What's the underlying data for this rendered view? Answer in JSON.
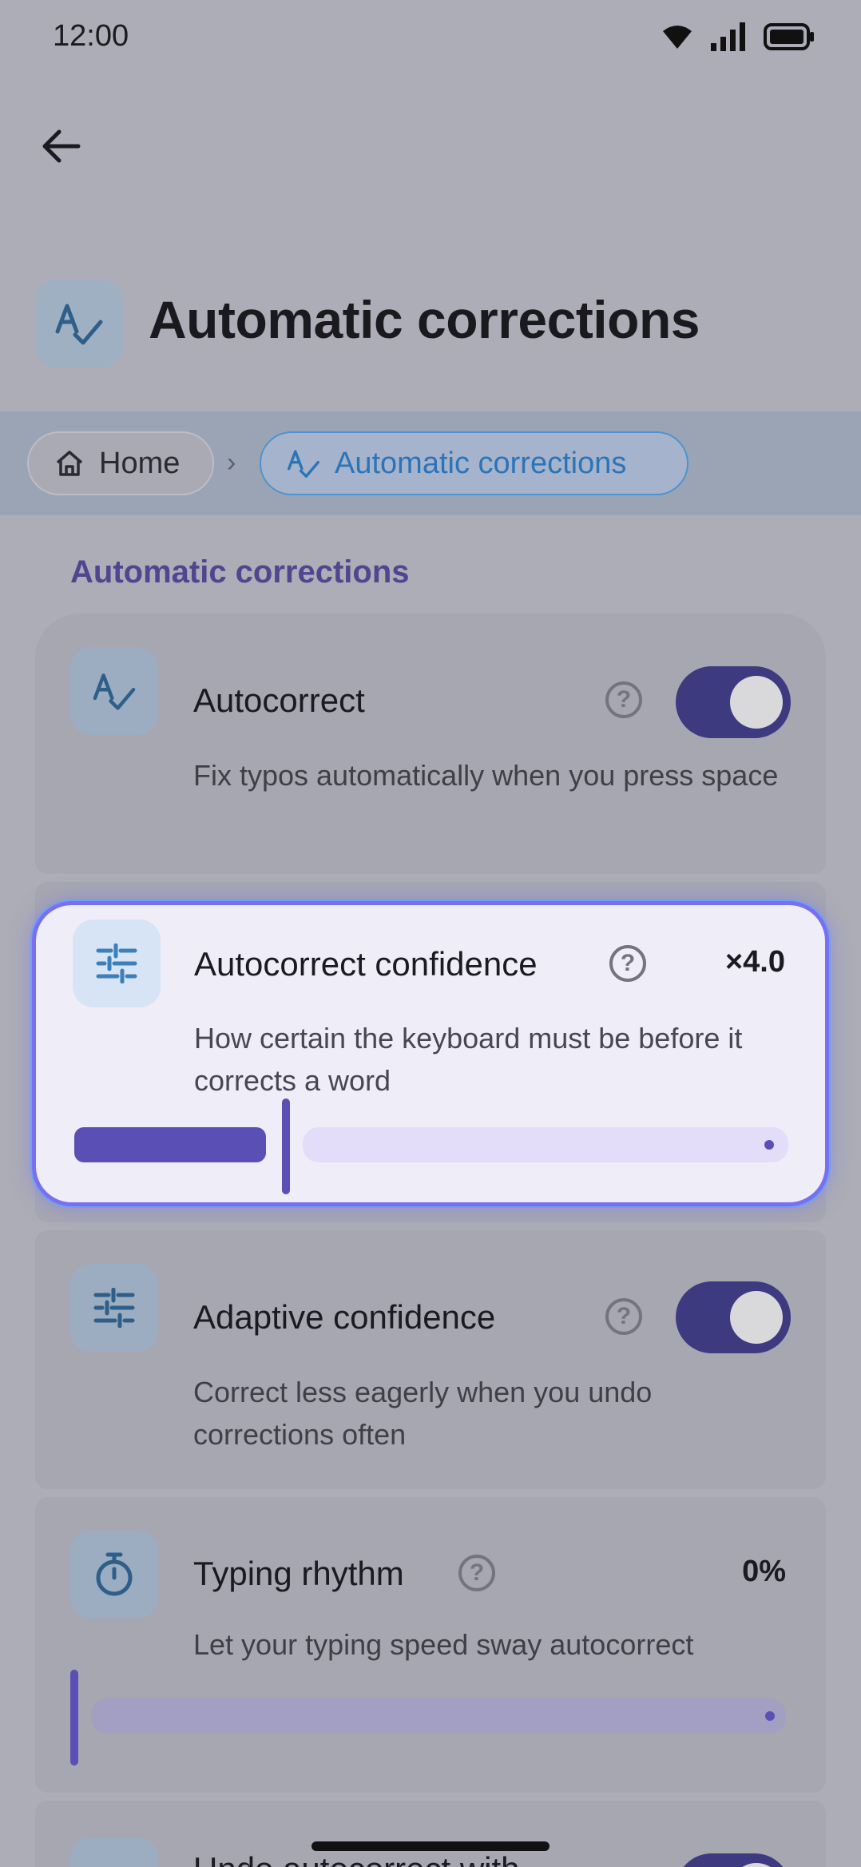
{
  "status": {
    "time": "12:00"
  },
  "header": {
    "title": "Automatic corrections"
  },
  "breadcrumb": {
    "home": "Home",
    "separator": "›",
    "current": "Automatic corrections"
  },
  "section": {
    "title": "Automatic corrections"
  },
  "settings": {
    "autocorrect": {
      "label": "Autocorrect",
      "description": "Fix typos automatically when you press space",
      "enabled": true
    },
    "confidence": {
      "label": "Autocorrect confidence",
      "description": "How certain the keyboard must be before it corrects a word",
      "value": "×4.0",
      "level": 0.28
    },
    "adaptive": {
      "label": "Adaptive confidence",
      "description": "Correct less eagerly when you undo corrections often",
      "enabled": true
    },
    "rhythm": {
      "label": "Typing rhythm",
      "description": "Let your typing speed sway autocorrect",
      "value": "0%",
      "level": 0
    },
    "undo": {
      "label": "Undo autocorrect with",
      "enabled": true
    }
  },
  "colors": {
    "accent": "#3e3a80",
    "focus_border": "#7a6ff0",
    "breadcrumb_active": "#2c74b8"
  }
}
